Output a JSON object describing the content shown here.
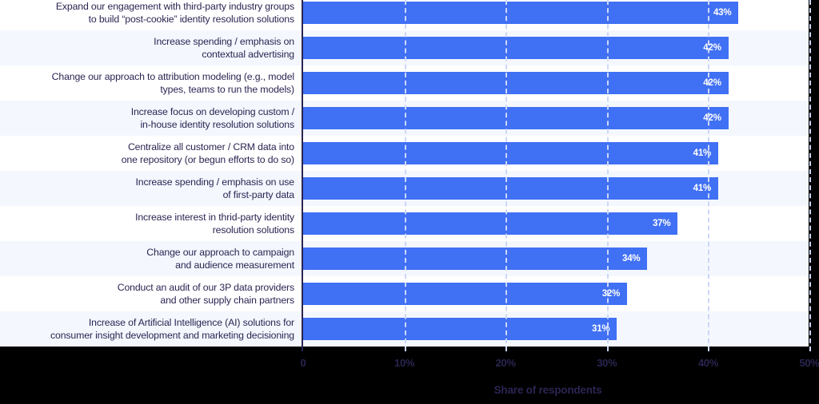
{
  "chart_data": {
    "type": "bar",
    "orientation": "horizontal",
    "title": "",
    "xlabel": "Share of respondents",
    "ylabel": "",
    "xlim": [
      0,
      50
    ],
    "grid": true,
    "legend": null,
    "xticks": [
      "0",
      "10%",
      "20%",
      "30%",
      "40%",
      "50%"
    ],
    "xtick_values": [
      0,
      10,
      20,
      30,
      40,
      50
    ],
    "value_suffix": "%",
    "colors": {
      "bar": "#4070f4",
      "bar_label": "#ffffff",
      "category_label": "#2a2552",
      "axis_text": "#2a2552",
      "row_band_odd": "#ffffff",
      "row_band_even": "#f4f7fe",
      "gridline": "#ccd8f7",
      "axis_line": "#2a2552",
      "page_background": "#000000"
    },
    "categories": [
      "Expand our engagement with third-party industry groups\nto build “post-cookie” identity resolution solutions",
      "Increase spending / emphasis on\ncontextual advertising",
      "Change our approach to attribution modeling (e.g., model\ntypes, teams to run the models)",
      "Increase focus on developing custom /\nin-house identity resolution solutions",
      "Centralize all customer / CRM data into\none repository (or begun efforts to do so)",
      "Increase spending / emphasis on use\nof first-party data",
      "Increase interest in thrid-party identity\nresolution solutions",
      "Change our approach to campaign\nand audience measurement",
      "Conduct an audit of our 3P data providers\nand other supply chain partners",
      "Increase of Artificial Intelligence (AI) solutions for\nconsumer insight development and marketing decisioning"
    ],
    "values": [
      43,
      42,
      42,
      42,
      41,
      41,
      37,
      34,
      32,
      31
    ],
    "value_labels": [
      "43%",
      "42%",
      "42%",
      "42%",
      "41%",
      "41%",
      "37%",
      "34%",
      "32%",
      "31%"
    ]
  }
}
